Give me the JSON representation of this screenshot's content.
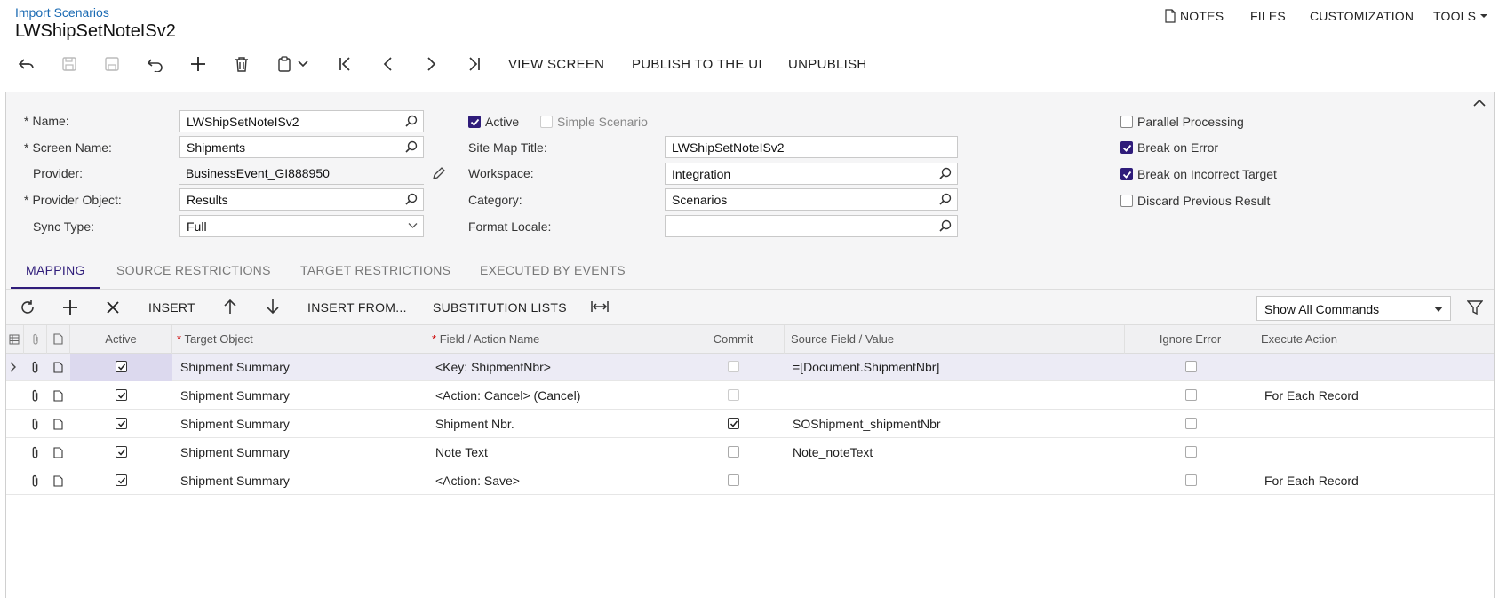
{
  "header": {
    "breadcrumb": "Import Scenarios",
    "title": "LWShipSetNoteISv2",
    "notes": "NOTES",
    "files": "FILES",
    "customization": "CUSTOMIZATION",
    "tools": "TOOLS"
  },
  "toolbar": {
    "view_screen": "VIEW SCREEN",
    "publish": "PUBLISH TO THE UI",
    "unpublish": "UNPUBLISH"
  },
  "form": {
    "name_label": "Name:",
    "name_value": "LWShipSetNoteISv2",
    "screen_name_label": "Screen Name:",
    "screen_name_value": "Shipments",
    "provider_label": "Provider:",
    "provider_value": "BusinessEvent_GI888950",
    "provider_object_label": "Provider Object:",
    "provider_object_value": "Results",
    "sync_type_label": "Sync Type:",
    "sync_type_value": "Full",
    "active_label": "Active",
    "simple_scenario_label": "Simple Scenario",
    "site_map_title_label": "Site Map Title:",
    "site_map_title_value": "LWShipSetNoteISv2",
    "workspace_label": "Workspace:",
    "workspace_value": "Integration",
    "category_label": "Category:",
    "category_value": "Scenarios",
    "format_locale_label": "Format Locale:",
    "format_locale_value": "",
    "parallel_processing_label": "Parallel Processing",
    "break_on_error_label": "Break on Error",
    "break_on_incorrect_target_label": "Break on Incorrect Target",
    "discard_previous_result_label": "Discard Previous Result",
    "required_mark": "*"
  },
  "tabs": {
    "mapping": "MAPPING",
    "source_restrictions": "SOURCE RESTRICTIONS",
    "target_restrictions": "TARGET RESTRICTIONS",
    "executed_by_events": "EXECUTED BY EVENTS"
  },
  "grid_toolbar": {
    "insert": "INSERT",
    "insert_from": "INSERT FROM...",
    "substitution_lists": "SUBSTITUTION LISTS",
    "show_all_commands": "Show All Commands"
  },
  "grid": {
    "headers": {
      "active": "Active",
      "target_object": "Target Object",
      "field_action": "Field / Action Name",
      "commit": "Commit",
      "source_field": "Source Field / Value",
      "ignore_error": "Ignore Error",
      "execute_action": "Execute Action"
    },
    "rows": [
      {
        "target": "Shipment Summary",
        "field": "<Key: ShipmentNbr>",
        "source": "=[Document.ShipmentNbr]",
        "execute": "",
        "commit": false
      },
      {
        "target": "Shipment Summary",
        "field": "<Action: Cancel> (Cancel)",
        "source": "",
        "execute": "For Each Record",
        "commit": false
      },
      {
        "target": "Shipment Summary",
        "field": "Shipment Nbr.",
        "source": "SOShipment_shipmentNbr",
        "execute": "",
        "commit": true
      },
      {
        "target": "Shipment Summary",
        "field": "Note Text",
        "source": "Note_noteText",
        "execute": "",
        "commit": false
      },
      {
        "target": "Shipment Summary",
        "field": "<Action: Save>",
        "source": "",
        "execute": "For Each Record",
        "commit": false
      }
    ]
  },
  "colors": {
    "accent": "#2f1c7a",
    "link": "#1a6ab3"
  }
}
